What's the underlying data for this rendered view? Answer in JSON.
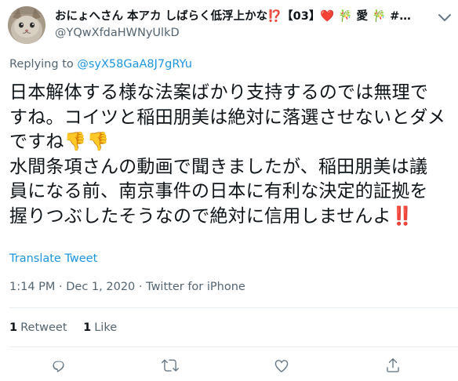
{
  "author": {
    "display_name": "おにょへさん 本アカ しばらく低浮上かな⁉️【03】❤️ 🎋 愛 🎋 #…",
    "handle": "@YQwXfdaHWNyUlkD"
  },
  "reply": {
    "prefix": "Replying to ",
    "mention": "@syX58GaA8J7gRYu"
  },
  "tweet": {
    "lines": [
      "日本解体する様な法案ばかり支持するのでは無理で",
      "すね。コイツと稲田朋美は絶対に落選させないとダメ",
      "ですね👎👎",
      "水間条項さんの動画で聞きましたが、稲田朋美は議",
      "員になる前、南京事件の日本に有利な決定的証拠を",
      "握りつぶしたそうなので絶対に信用しませんよ‼️"
    ]
  },
  "translate_label": "Translate Tweet",
  "meta": {
    "time": "1:14 PM",
    "separator": " · ",
    "date": "Dec 1, 2020",
    "source": "Twitter for iPhone"
  },
  "stats": {
    "retweets_count": "1",
    "retweets_label": "Retweet",
    "likes_count": "1",
    "likes_label": "Like"
  },
  "icons": {
    "more": "chevron-down-icon",
    "reply": "reply-icon",
    "retweet": "retweet-icon",
    "like": "heart-icon",
    "share": "share-icon"
  },
  "colors": {
    "link": "#1b95e0",
    "secondary_text": "#536471",
    "primary_text": "#0f1419",
    "divider": "#e6ecf0",
    "icon": "#657786"
  }
}
